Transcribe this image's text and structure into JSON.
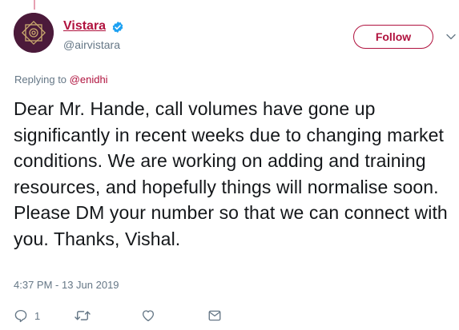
{
  "tweet": {
    "author": {
      "display_name": "Vistara",
      "handle": "@airvistara",
      "verified_icon": "verified-badge-icon"
    },
    "follow_label": "Follow",
    "replying_prefix": "Replying to",
    "replying_to": "@enidhi",
    "text": "Dear Mr. Hande, call volumes have gone up significantly in recent weeks due to changing market conditions. We are working on adding and training resources, and hopefully things will normalise soon. Please DM your number so that we can connect with you. Thanks, Vishal.",
    "timestamp": "4:37 PM - 13 Jun 2019",
    "actions": {
      "reply_count": "1",
      "retweet_count": "",
      "like_count": ""
    }
  },
  "icons": {
    "reply": "reply-icon",
    "retweet": "retweet-icon",
    "like": "heart-icon",
    "message": "envelope-icon",
    "more": "chevron-down-icon"
  },
  "colors": {
    "brand": "#b0123e",
    "text": "#14171a",
    "muted": "#657786",
    "verified": "#1da1f2",
    "avatar_bg": "#4b1a3a"
  }
}
